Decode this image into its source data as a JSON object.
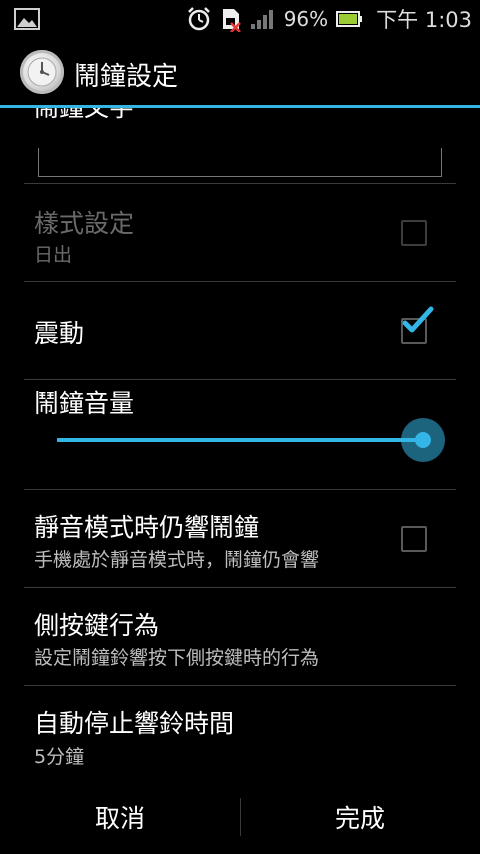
{
  "status_bar": {
    "battery_text": "96%",
    "time_text": "下午 1:03",
    "icons": [
      "image-icon",
      "alarm-clock-icon",
      "no-sim-icon",
      "signal-icon",
      "battery-icon"
    ]
  },
  "action_bar": {
    "title": "鬧鐘設定",
    "accent_color": "#33b5e5"
  },
  "content": {
    "clipped_item_title": "鬧鐘文字",
    "items": [
      {
        "title": "樣式設定",
        "subtitle": "日出",
        "checked": false,
        "enabled": false
      },
      {
        "title": "震動",
        "checked": true,
        "enabled": true
      },
      {
        "title": "鬧鐘音量",
        "volume_percent": 100
      },
      {
        "title": "靜音模式時仍響鬧鐘",
        "subtitle": "手機處於靜音模式時，鬧鐘仍會響",
        "checked": false
      },
      {
        "title": "側按鍵行為",
        "subtitle": "設定鬧鐘鈴響按下側按鍵時的行為"
      },
      {
        "title": "自動停止響鈴時間",
        "subtitle": "5分鐘"
      }
    ]
  },
  "buttons": {
    "cancel": "取消",
    "done": "完成"
  }
}
